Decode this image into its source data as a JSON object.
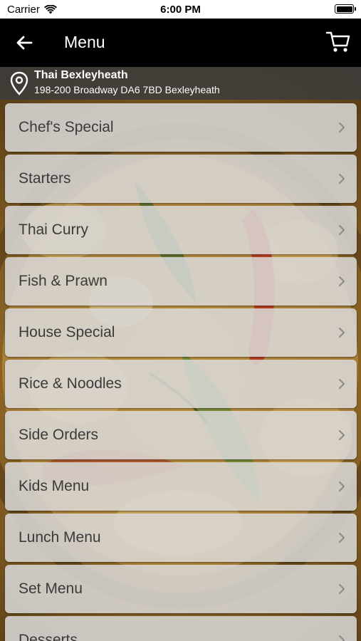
{
  "status_bar": {
    "carrier": "Carrier",
    "time": "6:00 PM"
  },
  "header": {
    "title": "Menu"
  },
  "location": {
    "name": "Thai Bexleyheath",
    "address": "198-200 Broadway DA6 7BD Bexleyheath"
  },
  "menu": {
    "items": [
      {
        "label": "Chef's Special"
      },
      {
        "label": "Starters"
      },
      {
        "label": "Thai Curry"
      },
      {
        "label": "Fish & Prawn"
      },
      {
        "label": "House Special"
      },
      {
        "label": "Rice & Noodles"
      },
      {
        "label": "Side Orders"
      },
      {
        "label": "Kids Menu"
      },
      {
        "label": "Lunch Menu"
      },
      {
        "label": "Set Menu"
      },
      {
        "label": "Desserts"
      }
    ]
  },
  "icons": {
    "wifi": "wifi-icon",
    "battery": "battery-icon",
    "back": "arrow-left-icon",
    "cart": "shopping-cart-icon",
    "pin": "map-pin-icon",
    "chevron": "chevron-right-icon"
  },
  "colors": {
    "header_bg": "#000000",
    "item_bg": "#dadada",
    "item_text": "#3b3b3b",
    "location_bg": "#3c3c3c"
  }
}
